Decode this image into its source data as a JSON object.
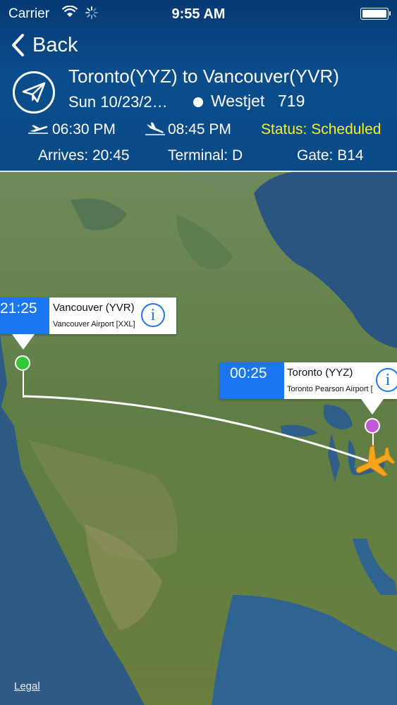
{
  "status_bar": {
    "carrier": "Carrier",
    "time": "9:55 AM"
  },
  "nav": {
    "back_label": "Back"
  },
  "flight": {
    "route": "Toronto(YYZ) to Vancouver(YVR)",
    "date": "Sun 10/23/2…",
    "airline": "Westjet",
    "number": "719",
    "departure_time": "06:30 PM",
    "arrival_time": "08:45 PM",
    "status": "Status: Scheduled",
    "arrives": "Arrives: 20:45",
    "terminal": "Terminal: D",
    "gate": "Gate: B14"
  },
  "map": {
    "destination": {
      "time": "21:25",
      "name": "Vancouver (YVR)",
      "airport": "Vancouver Airport [XXL]"
    },
    "origin": {
      "time": "00:25",
      "name": "Toronto (YYZ)",
      "airport": "Toronto Pearson Airport ["
    },
    "legal_label": "Legal"
  },
  "colors": {
    "header_bg": "#0b4d8c",
    "status_text": "#f5f02a",
    "callout_accent": "#1a77f0",
    "destination_pin": "#35c73a",
    "origin_pin": "#c05ad8",
    "plane": "#f2a51d"
  },
  "icons": [
    "wifi-icon",
    "activity-spinner-icon",
    "battery-icon",
    "chevron-left-icon",
    "paper-plane-icon",
    "takeoff-icon",
    "landing-icon",
    "info-icon",
    "airplane-icon"
  ]
}
